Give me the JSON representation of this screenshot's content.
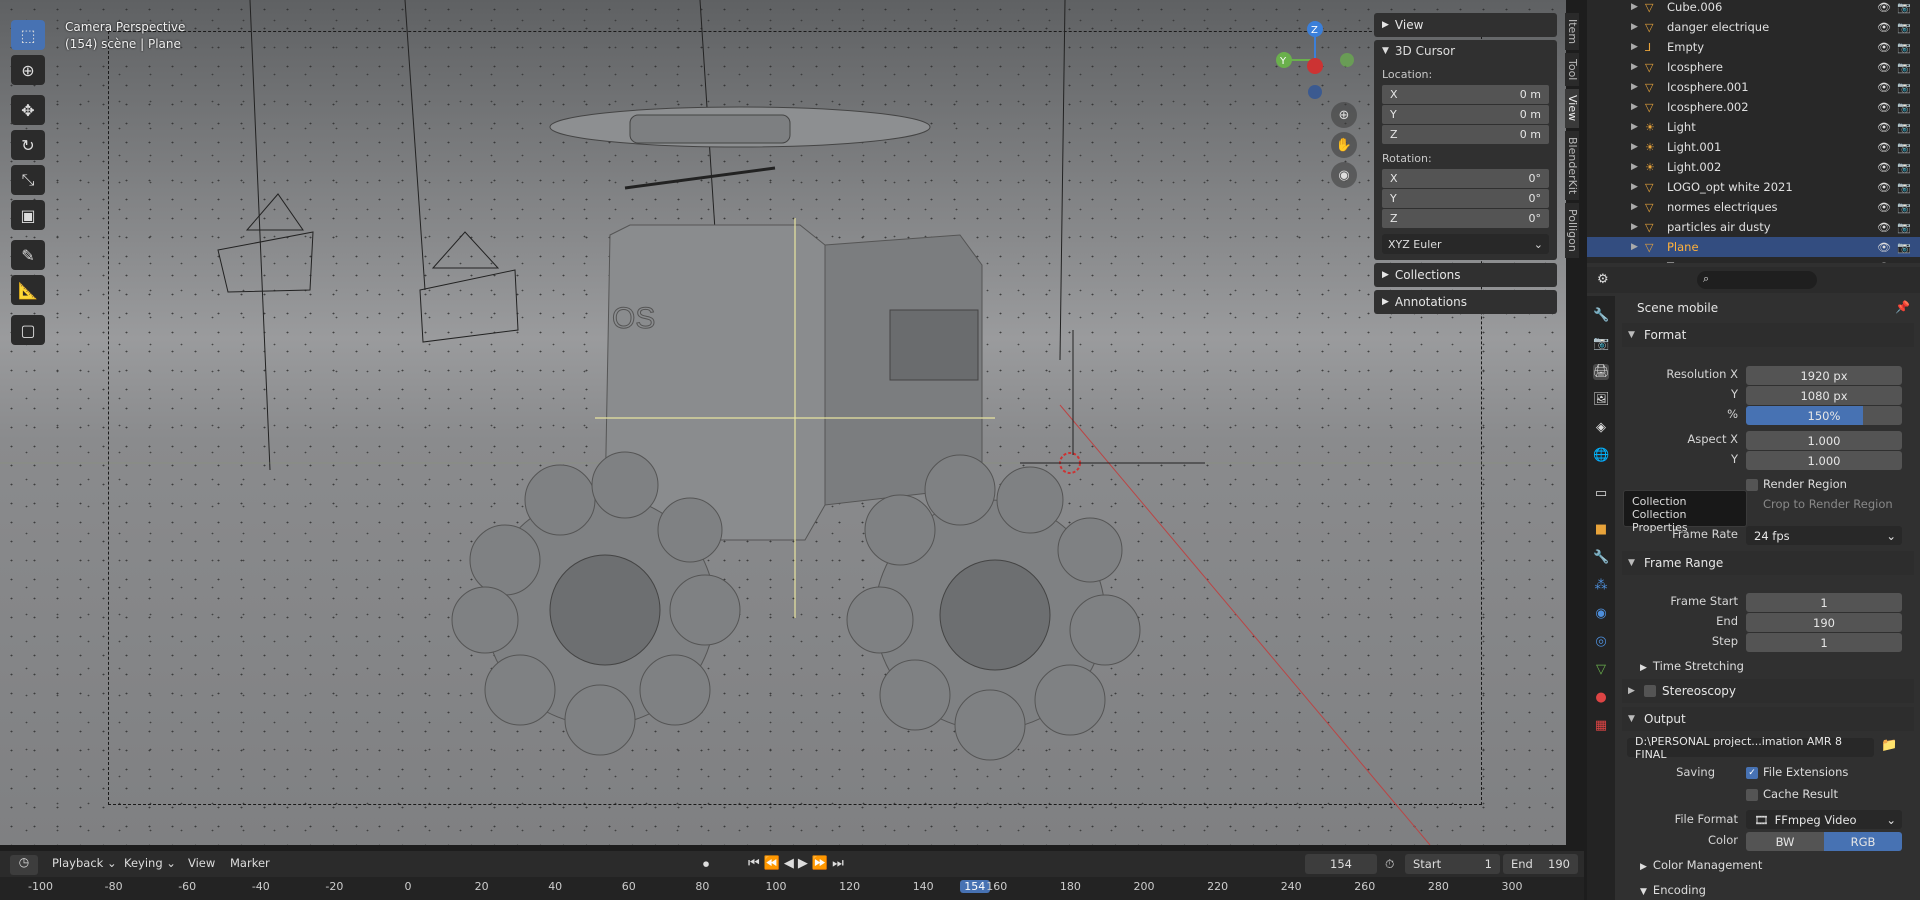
{
  "viewport": {
    "title": "Camera Perspective",
    "subtitle": "(154) scène | Plane",
    "tools": [
      "select-box-icon",
      "cursor-icon",
      "move-icon",
      "rotate-icon",
      "scale-icon",
      "transform-icon",
      "annotate-icon",
      "measure-icon",
      "add-cube-icon"
    ],
    "gizmo": {
      "z": "Z",
      "y": "Y"
    }
  },
  "npanel": {
    "view": "View",
    "cursor_title": "3D Cursor",
    "location_label": "Location:",
    "location": [
      {
        "axis": "X",
        "value": "0 m"
      },
      {
        "axis": "Y",
        "value": "0 m"
      },
      {
        "axis": "Z",
        "value": "0 m"
      }
    ],
    "rotation_label": "Rotation:",
    "rotation": [
      {
        "axis": "X",
        "value": "0°"
      },
      {
        "axis": "Y",
        "value": "0°"
      },
      {
        "axis": "Z",
        "value": "0°"
      }
    ],
    "rotation_mode": "XYZ Euler",
    "collections": "Collections",
    "annotations": "Annotations",
    "tabs": [
      "Item",
      "Tool",
      "View",
      "BlenderKit",
      "Polligon"
    ]
  },
  "outliner": {
    "items": [
      {
        "name": "Cube.006",
        "icon": "mesh"
      },
      {
        "name": "danger electrique",
        "icon": "mesh"
      },
      {
        "name": "Empty",
        "icon": "empty"
      },
      {
        "name": "Icosphere",
        "icon": "mesh"
      },
      {
        "name": "Icosphere.001",
        "icon": "mesh"
      },
      {
        "name": "Icosphere.002",
        "icon": "mesh"
      },
      {
        "name": "Light",
        "icon": "light"
      },
      {
        "name": "Light.001",
        "icon": "light"
      },
      {
        "name": "Light.002",
        "icon": "light"
      },
      {
        "name": "LOGO_opt white 2021",
        "icon": "mesh"
      },
      {
        "name": "normes electriques",
        "icon": "mesh"
      },
      {
        "name": "particles air dusty",
        "icon": "mesh"
      },
      {
        "name": "Plane",
        "icon": "mesh",
        "selected": true
      },
      {
        "name": "Torus",
        "icon": "mesh"
      }
    ]
  },
  "properties": {
    "scene_name": "Scene mobile",
    "format": "Format",
    "resolution_x_label": "Resolution X",
    "resolution_x": "1920 px",
    "y_label": "Y",
    "resolution_y": "1080 px",
    "pct_label": "%",
    "resolution_pct": "150%",
    "aspect_x_label": "Aspect X",
    "aspect_x": "1.000",
    "aspect_y": "1.000",
    "render_region": "Render Region",
    "crop_region": "Crop to Render Region",
    "frame_rate_label": "Frame Rate",
    "frame_rate": "24 fps",
    "frame_range": "Frame Range",
    "frame_start_label": "Frame Start",
    "frame_start": "1",
    "end_label": "End",
    "frame_end": "190",
    "step_label": "Step",
    "step": "1",
    "time_stretching": "Time Stretching",
    "stereoscopy": "Stereoscopy",
    "output": "Output",
    "output_path": "D:\\PERSONAL project...imation AMR 8 FINAL",
    "saving_label": "Saving",
    "file_extensions": "File Extensions",
    "cache_result": "Cache Result",
    "file_format_label": "File Format",
    "file_format": "FFmpeg Video",
    "color_label": "Color",
    "color_bw": "BW",
    "color_rgb": "RGB",
    "color_management": "Color Management",
    "encoding": "Encoding"
  },
  "tooltip": {
    "title": "Collection",
    "desc": "Collection Properties"
  },
  "timeline": {
    "menu": [
      "Playback",
      "Keying",
      "View",
      "Marker"
    ],
    "current_frame": "154",
    "start_label": "Start",
    "start": "1",
    "end_label": "End",
    "end": "190",
    "ruler": [
      "-100",
      "-80",
      "-60",
      "-40",
      "-20",
      "0",
      "20",
      "40",
      "60",
      "80",
      "100",
      "120",
      "140",
      "154",
      "160",
      "180",
      "200",
      "220",
      "240",
      "260",
      "280",
      "300"
    ]
  },
  "colors": {
    "accent": "#4772b3",
    "selected_row": "#334d80",
    "mesh_icon": "#e8a33a"
  }
}
